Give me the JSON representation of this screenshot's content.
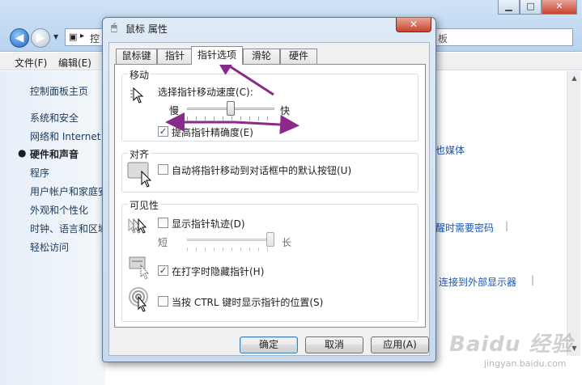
{
  "background": {
    "caption_buttons": {
      "minimize": "▁",
      "maximize": "□",
      "close": "✕"
    },
    "address_fragment": "控",
    "search_fragment": "板",
    "menu": [
      "文件(F)",
      "编辑(E)"
    ],
    "left_pane": {
      "home": "控制面板主页",
      "items": [
        "系统和安全",
        "网络和 Internet",
        "硬件和声音",
        "程序",
        "用户帐户和家庭安",
        "外观和个性化",
        "时钟、语言和区域",
        "轻松访问"
      ],
      "active_index": 2
    },
    "right_links": [
      "也媒体",
      "醒时需要密码",
      "连接到外部显示器"
    ],
    "watermark": "Baidu 经验",
    "watermark_sub": "jingyan.baidu.com"
  },
  "dialog": {
    "title": "鼠标 属性",
    "close_label": "✕",
    "tabs": [
      "鼠标键",
      "指针",
      "指针选项",
      "滑轮",
      "硬件"
    ],
    "active_tab": "指针选项",
    "motion": {
      "group_label": "移动",
      "speed_label": "选择指针移动速度(C):",
      "slow": "慢",
      "fast": "快",
      "speed_value_fraction": 0.5,
      "precision_label": "提高指针精确度(E)",
      "precision_checked": true
    },
    "snap_to": {
      "group_label": "对齐",
      "label": "自动将指针移动到对话框中的默认按钮(U)",
      "checked": false
    },
    "visibility": {
      "group_label": "可见性",
      "trails_label": "显示指针轨迹(D)",
      "trails_checked": false,
      "trail_short": "短",
      "trail_long": "长",
      "trail_value_fraction": 1.0,
      "hide_typing_label": "在打字时隐藏指针(H)",
      "hide_typing_checked": true,
      "show_location_label": "当按 CTRL 键时显示指针的位置(S)",
      "show_location_checked": false
    },
    "buttons": {
      "ok": "确定",
      "cancel": "取消",
      "apply": "应用(A)"
    },
    "check_mark": "✓",
    "annotation_color": "#8a2a8a"
  }
}
